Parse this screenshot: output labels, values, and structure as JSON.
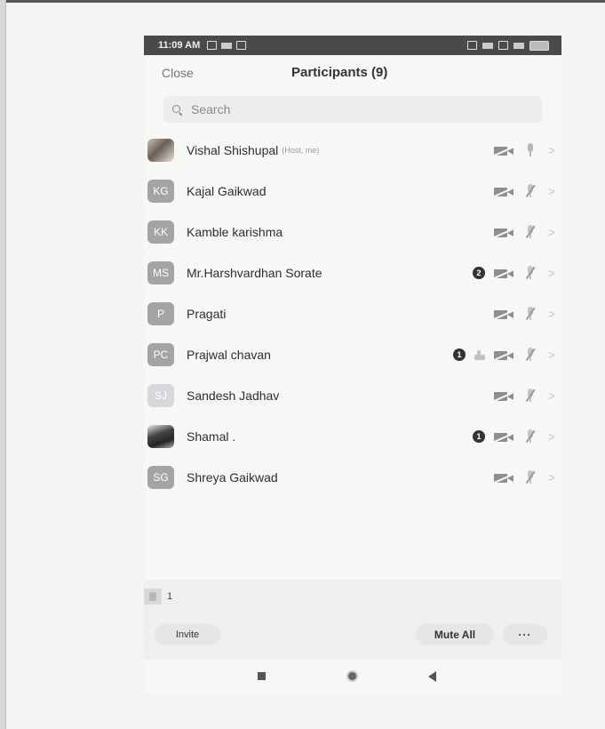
{
  "status_bar": {
    "time": "11:09 AM"
  },
  "header": {
    "close_label": "Close",
    "title": "Participants (9)"
  },
  "search": {
    "placeholder": "Search"
  },
  "participants": [
    {
      "initials": "",
      "name": "Vishal Shishupal",
      "tag": "(Host, me)",
      "avatar": "photo",
      "video": "off",
      "mic": "on"
    },
    {
      "initials": "KG",
      "name": "Kajal Gaikwad",
      "tag": "",
      "avatar": "gray",
      "video": "off",
      "mic": "muted"
    },
    {
      "initials": "KK",
      "name": "Kamble karishma",
      "tag": "",
      "avatar": "gray",
      "video": "off",
      "mic": "muted"
    },
    {
      "initials": "MS",
      "name": "Mr.Harshvardhan Sorate",
      "tag": "",
      "avatar": "gray",
      "badge": "2",
      "video": "off",
      "mic": "muted"
    },
    {
      "initials": "P",
      "name": "Pragati",
      "tag": "",
      "avatar": "gray",
      "video": "off",
      "mic": "muted"
    },
    {
      "initials": "PC",
      "name": "Prajwal chavan",
      "tag": "",
      "avatar": "gray",
      "badge": "1",
      "hand_raised": true,
      "video": "off",
      "mic": "muted"
    },
    {
      "initials": "SJ",
      "name": "Sandesh Jadhav",
      "tag": "",
      "avatar": "light",
      "video": "off",
      "mic": "muted"
    },
    {
      "initials": "",
      "name": "Shamal .",
      "tag": "",
      "avatar": "photo2",
      "badge": "1",
      "video": "off",
      "mic": "muted"
    },
    {
      "initials": "SG",
      "name": "Shreya Gaikwad",
      "tag": "",
      "avatar": "gray",
      "video": "off",
      "mic": "muted"
    }
  ],
  "footer": {
    "raised_hands_count": "1",
    "invite_label": "Invite",
    "mute_all_label": "Mute All",
    "more_label": "···"
  }
}
